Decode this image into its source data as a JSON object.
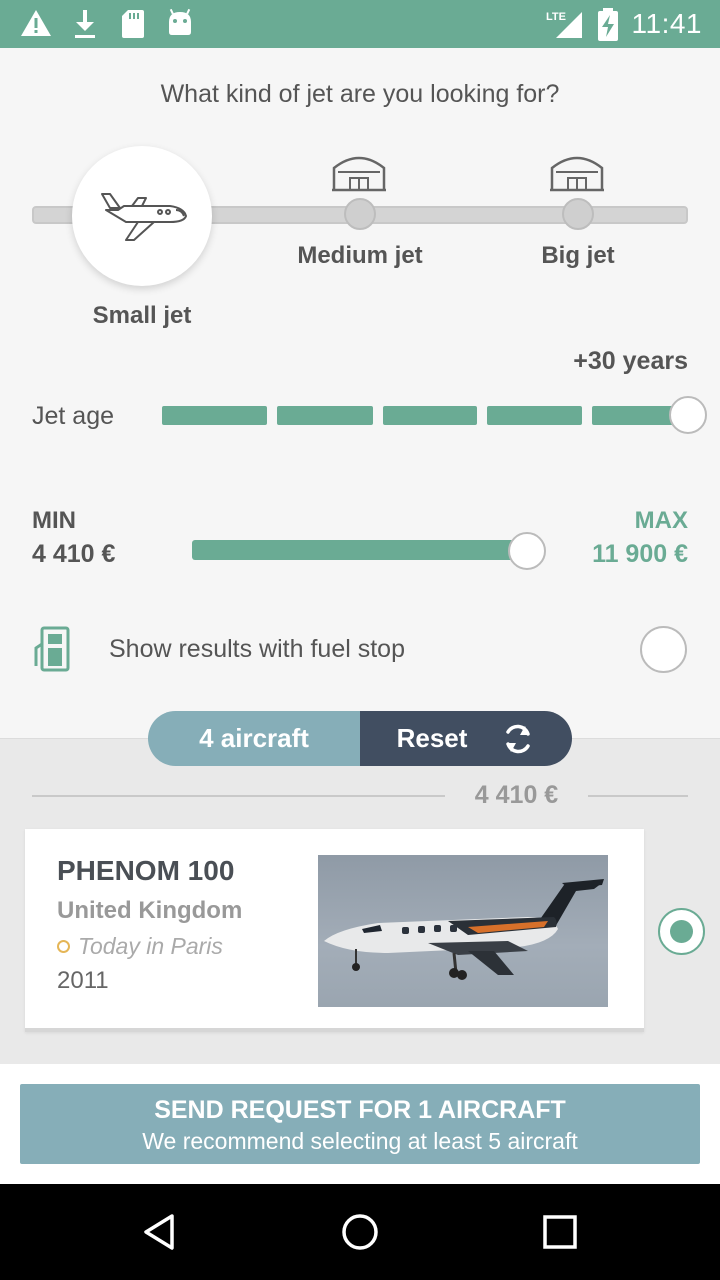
{
  "status_bar": {
    "time": "11:41",
    "network": "LTE"
  },
  "question": "What kind of jet are you looking for?",
  "jet_types": {
    "selected_index": 0,
    "items": [
      {
        "label": "Small jet",
        "icon": "airplane-icon"
      },
      {
        "label": "Medium jet",
        "icon": "hangar-icon"
      },
      {
        "label": "Big jet",
        "icon": "hangar-icon"
      }
    ]
  },
  "jet_age": {
    "label": "Jet age",
    "value": "+30 years",
    "level": 1.0,
    "segments": 5
  },
  "price": {
    "min_label": "MIN",
    "min_value": "4 410 €",
    "max_label": "MAX",
    "max_value": "11 900 €",
    "fill_fraction": 1.0
  },
  "fuel_stop": {
    "label": "Show results with fuel stop",
    "checked": false
  },
  "results_bar": {
    "count_label": "4 aircraft",
    "reset_label": "Reset"
  },
  "price_separator": "4 410 €",
  "aircraft": [
    {
      "name": "PHENOM 100",
      "country": "United Kingdom",
      "availability": "Today in Paris",
      "year": "2011",
      "selected": true
    }
  ],
  "send": {
    "title": "SEND REQUEST FOR 1 AIRCRAFT",
    "subtitle": "We recommend selecting at least 5 aircraft"
  },
  "colors": {
    "accent": "#6aab94",
    "dark": "#414e61",
    "muted_blue": "#86aeb8"
  }
}
